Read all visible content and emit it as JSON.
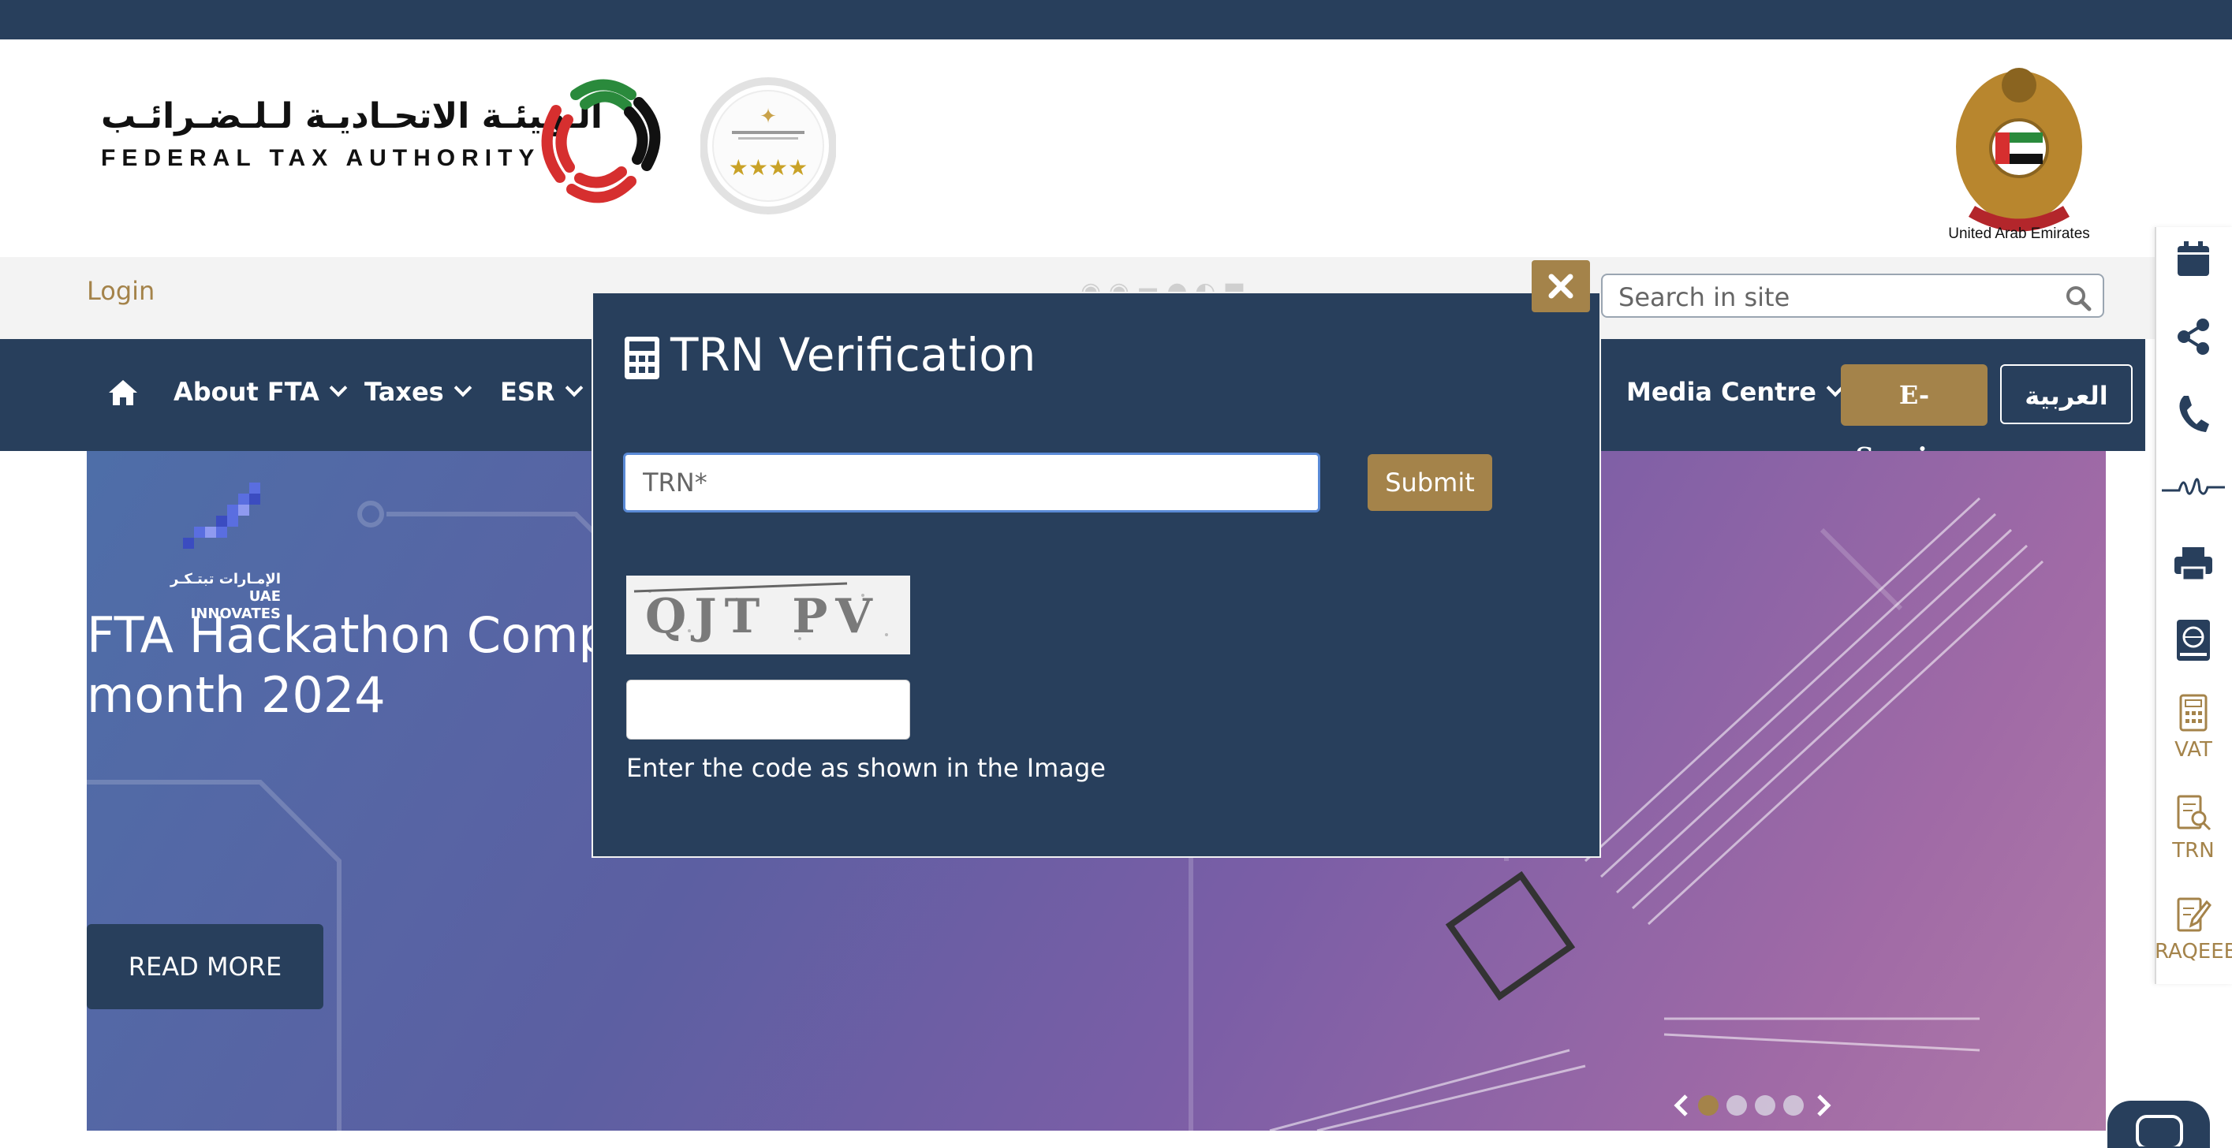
{
  "header": {
    "logo_arabic": "الـهيئـة الاتحـاديـة لـلـضـرائـب",
    "logo_english": "FEDERAL TAX AUTHORITY",
    "uae_label": "United Arab Emirates"
  },
  "utility_bar": {
    "login_label": "Login",
    "search_placeholder": "Search in site"
  },
  "nav": {
    "items": [
      {
        "label": "About FTA"
      },
      {
        "label": "Taxes"
      },
      {
        "label": "ESR"
      },
      {
        "label": "Media Centre"
      }
    ],
    "eservices_label": "E-Services",
    "arabic_label": "العربية"
  },
  "hero": {
    "title_line1": "FTA Hackathon Comp",
    "title_line2": "month 2024",
    "read_more_label": "READ MORE",
    "innovates_ar": "الإمـارات تبتـكـر",
    "innovates_en": "UAE INNOVATES",
    "slide_count": 4,
    "active_slide": 1
  },
  "sidebar": {
    "items": [
      {
        "icon": "calendar-icon"
      },
      {
        "icon": "share-icon"
      },
      {
        "icon": "phone-icon"
      },
      {
        "icon": "signature-icon"
      },
      {
        "icon": "print-icon"
      },
      {
        "icon": "globe-book-icon"
      },
      {
        "icon": "calculator-icon",
        "label": "VAT"
      },
      {
        "icon": "document-search-icon",
        "label": "TRN"
      },
      {
        "icon": "edit-document-icon",
        "label": "RAQEEB"
      }
    ]
  },
  "modal": {
    "title": "TRN Verification",
    "trn_placeholder": "TRN*",
    "submit_label": "Submit",
    "captcha_text": "QJT PV",
    "captcha_hint": "Enter the code as shown in the Image"
  },
  "colors": {
    "navy": "#283f5c",
    "gold": "#a4834a"
  }
}
